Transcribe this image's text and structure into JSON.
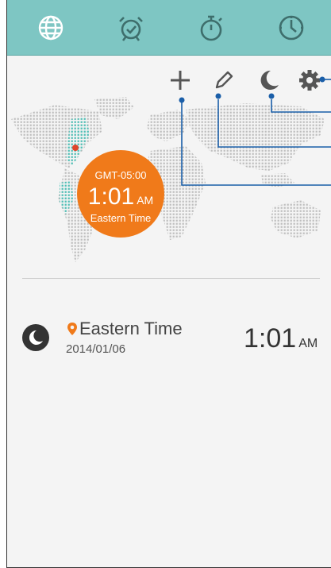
{
  "tabs": [
    {
      "name": "world-clock",
      "icon": "globe-icon"
    },
    {
      "name": "alarm",
      "icon": "alarm-clock-icon"
    },
    {
      "name": "stopwatch",
      "icon": "stopwatch-icon"
    },
    {
      "name": "timer",
      "icon": "timer-icon"
    }
  ],
  "toolbar": {
    "add_icon": "plus-icon",
    "edit_icon": "pencil-icon",
    "night_icon": "moon-icon",
    "settings_icon": "gear-icon"
  },
  "map_bubble": {
    "gmt": "GMT-05:00",
    "time": "1:01",
    "ampm": "AM",
    "zone": "Eastern Time"
  },
  "city_list": [
    {
      "city": "Eastern Time",
      "date": "2014/01/06",
      "time": "1:01",
      "ampm": "AM"
    }
  ],
  "colors": {
    "tab_bar": "#7ec6c3",
    "accent": "#f07a1a",
    "callout": "#1a5ea8"
  }
}
